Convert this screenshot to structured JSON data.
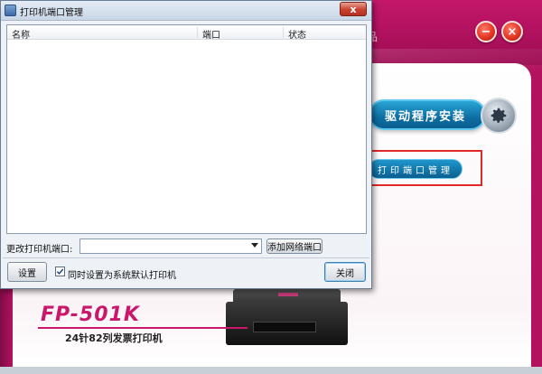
{
  "installer": {
    "brand_fragment": "品",
    "minimize_glyph": "−",
    "close_glyph": "×",
    "driver_install_label": "驱动程序安装",
    "port_management_label": "打印端口管理",
    "model_name": "FP-501K",
    "model_description": "24针82列发票打印机",
    "icons": [
      "gear-icon",
      "printer-image"
    ],
    "colors": {
      "accent": "#b3125f",
      "button_blue": "#0d6ea3",
      "highlight": "#e0282a"
    }
  },
  "dialog": {
    "title": "打印机端口管理",
    "close_glyph": "x",
    "columns": [
      "名称",
      "端口",
      "状态"
    ],
    "rows": [],
    "change_port_label": "更改打印机端口:",
    "port_select_value": "",
    "add_network_port_label": "添加网络端口",
    "settings_label": "设置",
    "default_printer_label": "同时设置为系统默认打印机",
    "default_printer_checked": true,
    "close_label": "关闭"
  }
}
